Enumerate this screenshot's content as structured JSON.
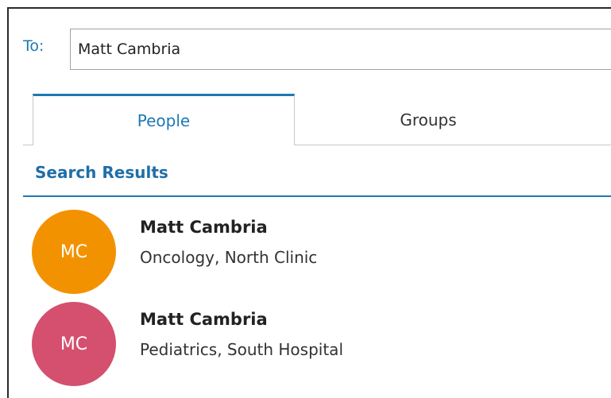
{
  "recipient": {
    "label": "To:",
    "value": "Matt Cambria",
    "placeholder": ""
  },
  "tabs": [
    {
      "label": "People",
      "selected": true
    },
    {
      "label": "Groups",
      "selected": false
    }
  ],
  "search": {
    "section_title": "Search Results",
    "results": [
      {
        "initials": "MC",
        "name": "Matt Cambria",
        "detail": "Oncology, North Clinic",
        "avatar_color": "#f39200"
      },
      {
        "initials": "MC",
        "name": "Matt Cambria",
        "detail": "Pediatrics, South Hospital",
        "avatar_color": "#d4506e"
      }
    ]
  },
  "colors": {
    "accent": "#1f78b4",
    "frame_border": "#2b2b2b"
  }
}
